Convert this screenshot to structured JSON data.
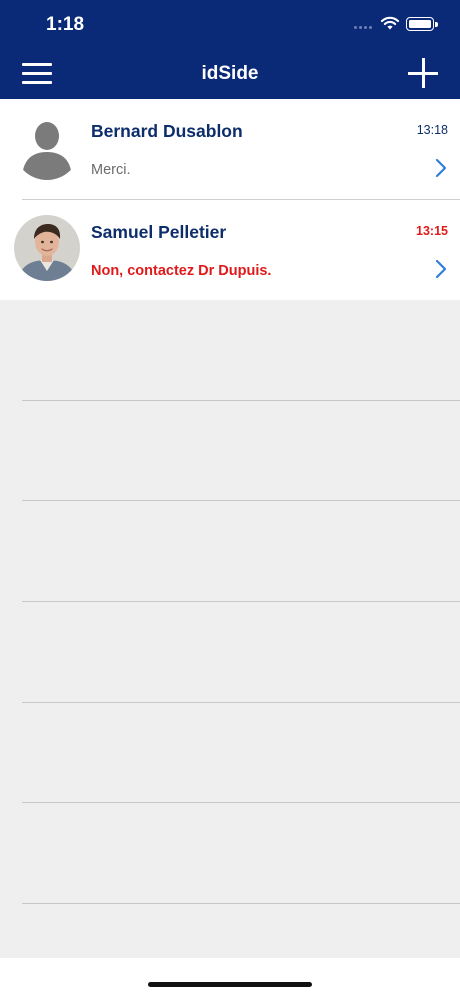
{
  "status_bar": {
    "time": "1:18"
  },
  "nav": {
    "title": "idSide",
    "menu_icon": "hamburger-menu-icon",
    "add_icon": "plus-icon",
    "background_color": "#0a2a78"
  },
  "conversations": [
    {
      "name": "Bernard Dusablon",
      "time": "13:18",
      "last_message": "Merci.",
      "unread": false,
      "avatar": "default-person-silhouette-icon"
    },
    {
      "name": "Samuel Pelletier",
      "time": "13:15",
      "last_message": "Non, contactez Dr Dupuis.",
      "unread": true,
      "avatar": "profile-photo"
    }
  ],
  "colors": {
    "name": "#0d2d6b",
    "unread": "#e01a1a",
    "chevron": "#2f7ed8",
    "divider": "#cfcfcf"
  }
}
